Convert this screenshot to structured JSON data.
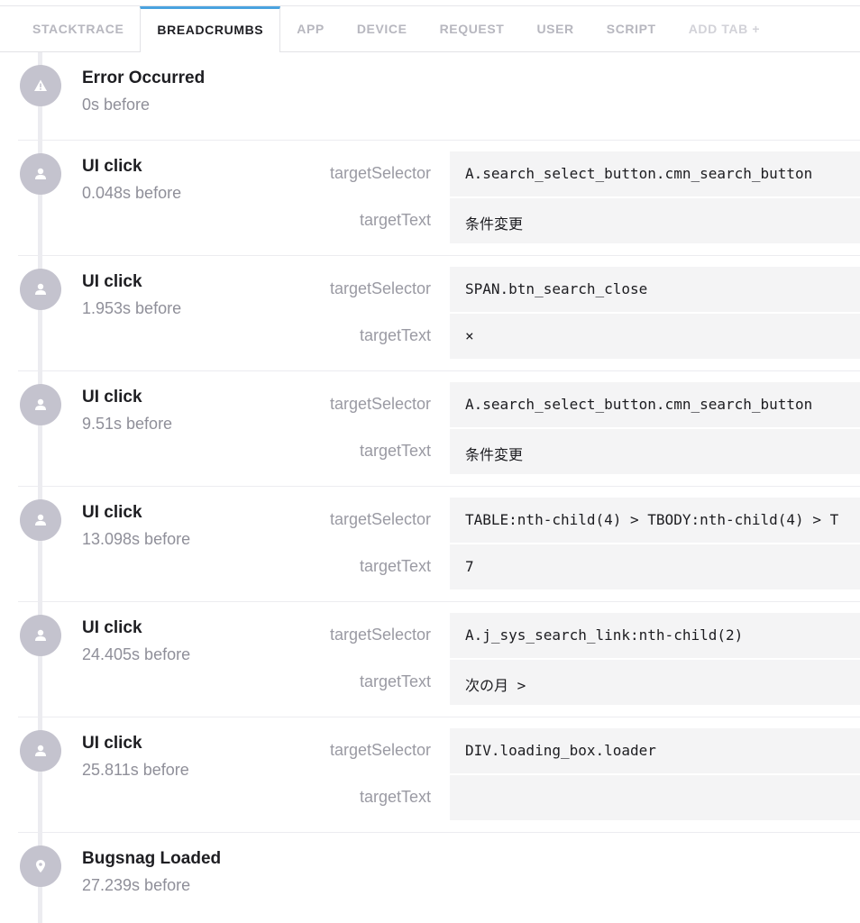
{
  "tabs": [
    {
      "label": "STACKTRACE",
      "active": false
    },
    {
      "label": "BREADCRUMBS",
      "active": true
    },
    {
      "label": "APP",
      "active": false
    },
    {
      "label": "DEVICE",
      "active": false
    },
    {
      "label": "REQUEST",
      "active": false
    },
    {
      "label": "USER",
      "active": false
    },
    {
      "label": "SCRIPT",
      "active": false
    },
    {
      "label": "ADD TAB +",
      "active": false
    }
  ],
  "breadcrumbs": [
    {
      "icon": "warning-icon",
      "title": "Error Occurred",
      "time": "0s before",
      "meta": []
    },
    {
      "icon": "user-icon",
      "title": "UI click",
      "time": "0.048s before",
      "meta": [
        {
          "key": "targetSelector",
          "value": "A.search_select_button.cmn_search_button"
        },
        {
          "key": "targetText",
          "value": "条件変更"
        }
      ]
    },
    {
      "icon": "user-icon",
      "title": "UI click",
      "time": "1.953s before",
      "meta": [
        {
          "key": "targetSelector",
          "value": "SPAN.btn_search_close"
        },
        {
          "key": "targetText",
          "value": "×"
        }
      ]
    },
    {
      "icon": "user-icon",
      "title": "UI click",
      "time": "9.51s before",
      "meta": [
        {
          "key": "targetSelector",
          "value": "A.search_select_button.cmn_search_button"
        },
        {
          "key": "targetText",
          "value": "条件変更"
        }
      ]
    },
    {
      "icon": "user-icon",
      "title": "UI click",
      "time": "13.098s before",
      "meta": [
        {
          "key": "targetSelector",
          "value": "TABLE:nth-child(4) > TBODY:nth-child(4) > T"
        },
        {
          "key": "targetText",
          "value": "7"
        }
      ]
    },
    {
      "icon": "user-icon",
      "title": "UI click",
      "time": "24.405s before",
      "meta": [
        {
          "key": "targetSelector",
          "value": "A.j_sys_search_link:nth-child(2)"
        },
        {
          "key": "targetText",
          "value": "次の月 >"
        }
      ]
    },
    {
      "icon": "user-icon",
      "title": "UI click",
      "time": "25.811s before",
      "meta": [
        {
          "key": "targetSelector",
          "value": "DIV.loading_box.loader"
        },
        {
          "key": "targetText",
          "value": ""
        }
      ]
    },
    {
      "icon": "location-pin-icon",
      "title": "Bugsnag Loaded",
      "time": "27.239s before",
      "meta": []
    }
  ],
  "colors": {
    "accent": "#4aa3df",
    "icon_bg": "#c4c3ce",
    "value_bg": "#f4f4f5"
  }
}
